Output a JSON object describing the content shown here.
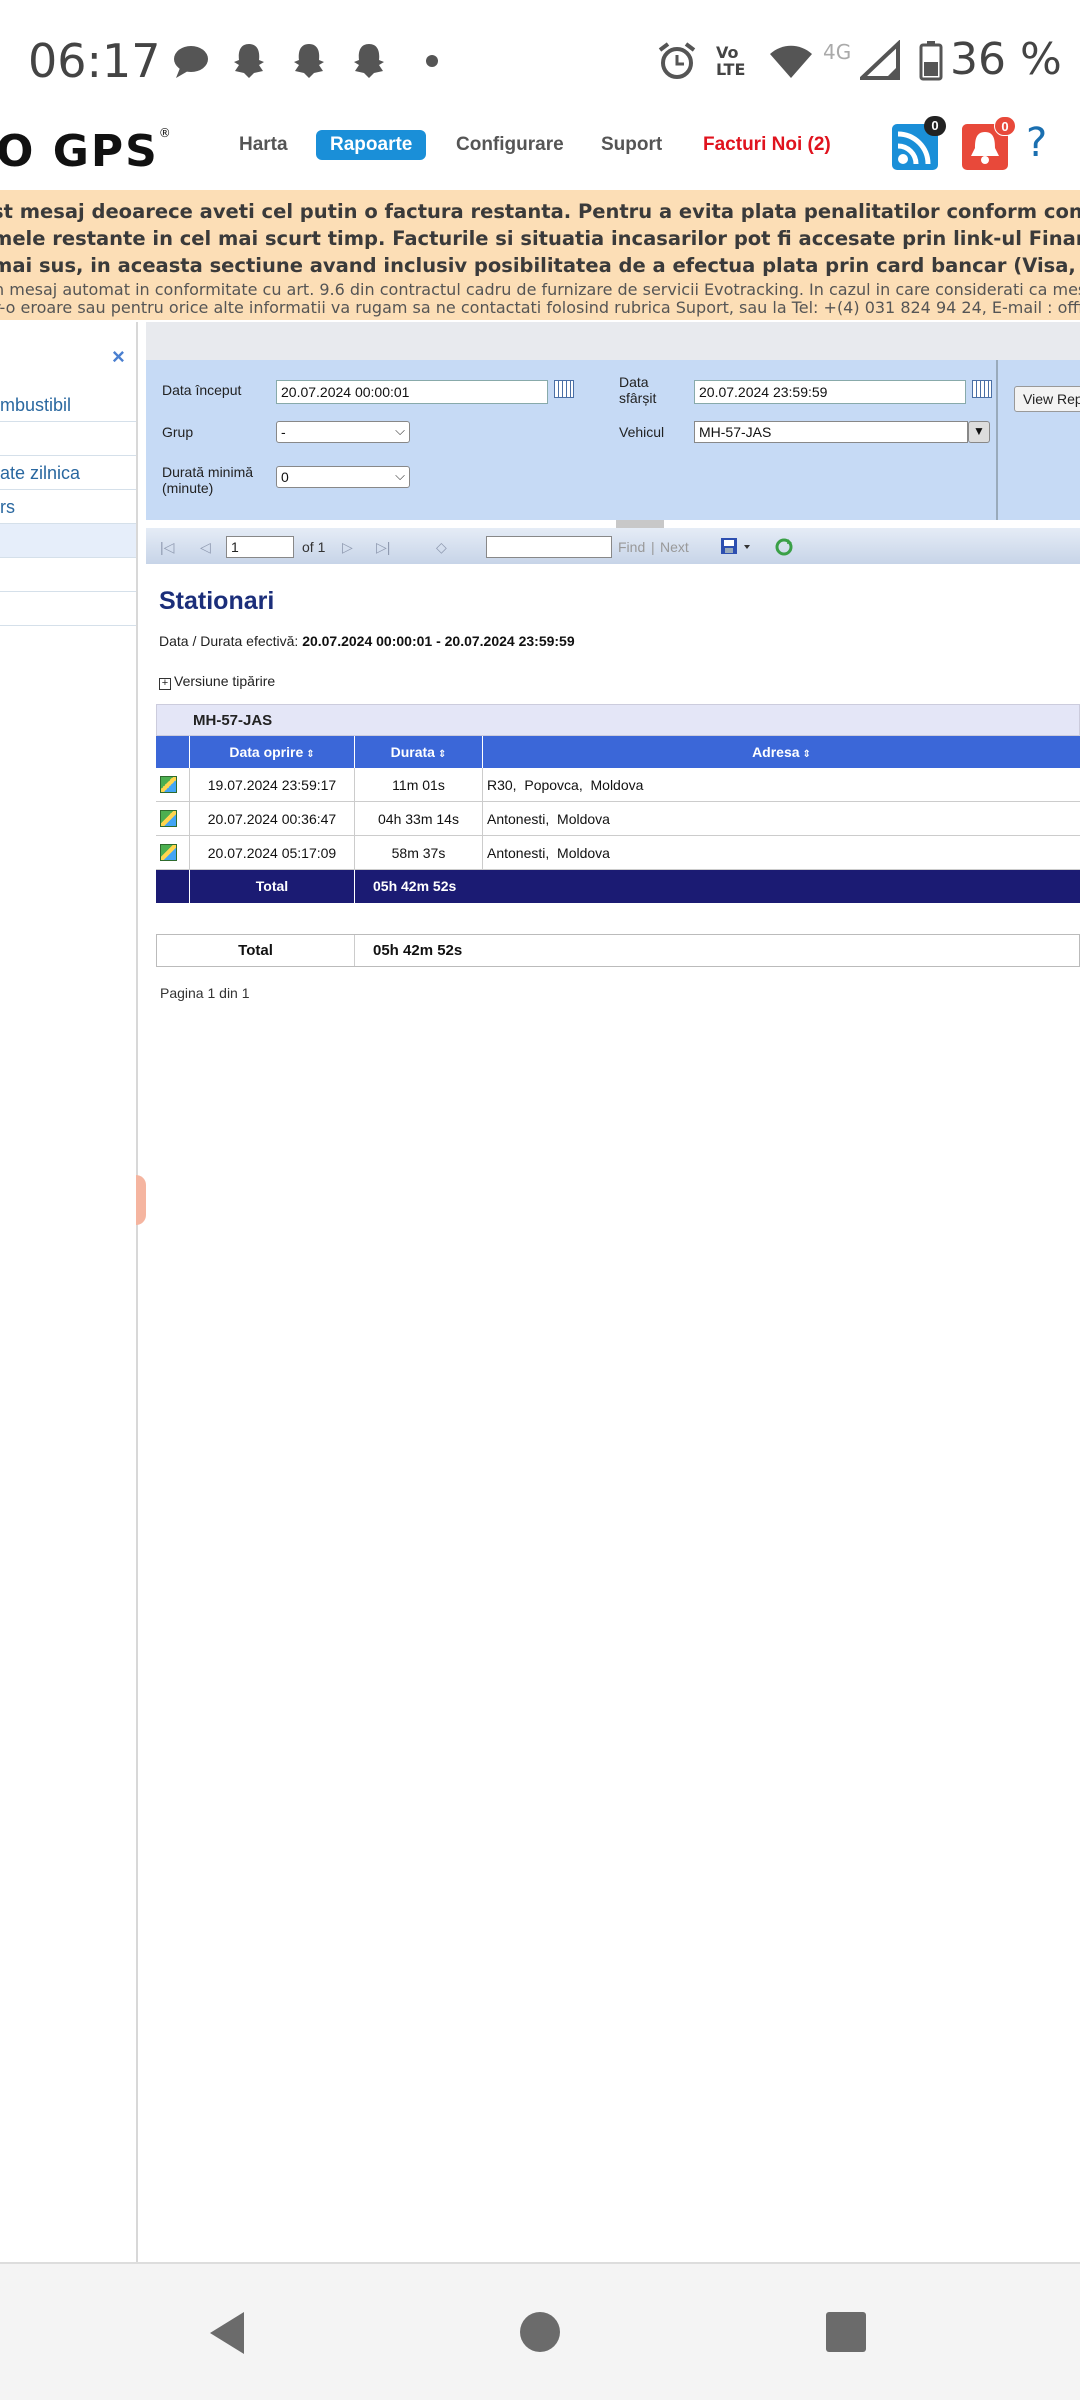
{
  "status_bar": {
    "time": "06:17",
    "battery": "36 %",
    "network": "4G",
    "volte": "Vo LTE"
  },
  "navbar": {
    "logo": "O GPS",
    "items": [
      "Harta",
      "Rapoarte",
      "Configurare",
      "Suport",
      "Facturi Noi (2)"
    ],
    "active": "Rapoarte",
    "rss_badge": "0",
    "bell_badge": "0",
    "help": "?"
  },
  "warning": {
    "line1": "st mesaj deoarece aveti cel putin o factura restanta. Pentru a evita plata penalitatilor conform contractului, va rugam sa",
    "line2": "mele restante in cel mai scurt timp. Facturile si situatia incasarilor pot fi accesate prin link-ul Financiar (sau Facturi Noi)",
    "line3": "mai sus, in aceasta sectiune avand inclusiv posibilitatea de a efectua plata prin card bancar (Visa, Mastercard).",
    "small1": "n mesaj automat in conformitate cu art. 9.6 din contractul cadru de furnizare de servicii Evotracking. In cazul in care considerati ca mesajul a fost",
    "small2": "r-o eroare sau pentru orice alte informatii va rugam sa ne contactati folosind rubrica Suport, sau la Tel: +(4) 031 824 94 24, E-mail : office@evogps"
  },
  "sidebar": {
    "close": "×",
    "items": [
      "mbustibil",
      "",
      "ate zilnica",
      "rs",
      "",
      "",
      ""
    ]
  },
  "filters": {
    "start_label": "Data început",
    "start_value": "20.07.2024 00:00:01",
    "end_label_1": "Data",
    "end_label_2": "sfârșit",
    "end_value": "20.07.2024 23:59:59",
    "group_label": "Grup",
    "group_value": "-",
    "vehicle_label": "Vehicul",
    "vehicle_value": "MH-57-JAS",
    "min_duration_label_1": "Durată minimă",
    "min_duration_label_2": "(minute)",
    "min_duration_value": "0",
    "view_button": "View Rep"
  },
  "toolbar": {
    "page": "1",
    "of": "of 1",
    "find": "Find",
    "sep": "|",
    "next": "Next"
  },
  "report": {
    "title": "Stationari",
    "subtitle_label": "Data / Durata efectivă:",
    "subtitle_value": "20.07.2024 00:00:01 - 20.07.2024 23:59:59",
    "print_version": "Versiune tipărire",
    "group_name": "MH-57-JAS",
    "columns": [
      "Data oprire",
      "Durata",
      "Adresa"
    ],
    "rows": [
      {
        "date": "19.07.2024 23:59:17",
        "duration": "11m 01s",
        "address": "R30,  Popovca,  Moldova"
      },
      {
        "date": "20.07.2024 00:36:47",
        "duration": "04h 33m 14s",
        "address": "Antonesti,  Moldova"
      },
      {
        "date": "20.07.2024 05:17:09",
        "duration": "58m 37s",
        "address": "Antonesti,  Moldova"
      }
    ],
    "total_label": "Total",
    "total_value": "05h 42m 52s",
    "grand_total_label": "Total",
    "grand_total_value": "05h 42m 52s",
    "pager": "Pagina 1 din 1"
  },
  "colors": {
    "accent": "#1a8fd8",
    "header_blue": "#3b67d8",
    "total_navy": "#1b1b73",
    "warning_bg": "#fcdeb6",
    "filter_bg": "#c6daf5"
  }
}
